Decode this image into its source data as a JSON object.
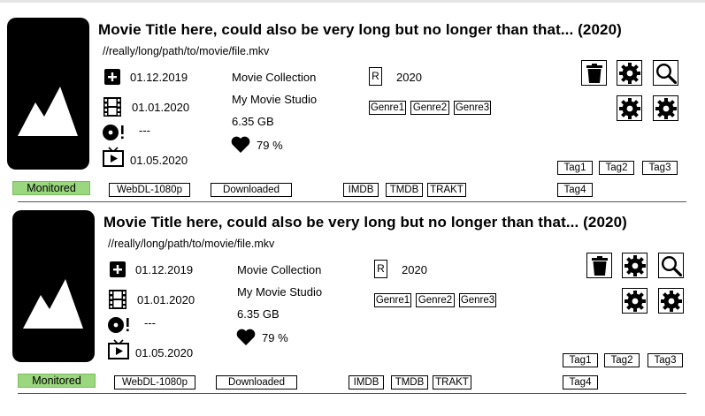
{
  "movies": [
    {
      "title": "Movie Title here, could also be very long but no longer than that... (2020)",
      "path": "//really/long/path/to/movie/file.mkv",
      "dates": {
        "added": "01.12.2019",
        "release": "01.01.2020",
        "digital": "---",
        "physical": "01.05.2020"
      },
      "collection": "Movie Collection",
      "studio": "My Movie Studio",
      "size": "6.35 GB",
      "rating": "79 %",
      "certification": "R",
      "year": "2020",
      "genres": [
        "Genre1",
        "Genre2",
        "Genre3"
      ],
      "tags": [
        "Tag1",
        "Tag2",
        "Tag3",
        "Tag4"
      ],
      "status": "Monitored",
      "quality": "WebDL-1080p",
      "file_status": "Downloaded",
      "links": [
        "IMDB",
        "TMDB",
        "TRAKT"
      ]
    },
    {
      "title": "Movie Title here, could also be very long but no longer than that... (2020)",
      "path": "//really/long/path/to/movie/file.mkv",
      "dates": {
        "added": "01.12.2019",
        "release": "01.01.2020",
        "digital": "---",
        "physical": "01.05.2020"
      },
      "collection": "Movie Collection",
      "studio": "My Movie Studio",
      "size": "6.35 GB",
      "rating": "79 %",
      "certification": "R",
      "year": "2020",
      "genres": [
        "Genre1",
        "Genre2",
        "Genre3"
      ],
      "tags": [
        "Tag1",
        "Tag2",
        "Tag3",
        "Tag4"
      ],
      "status": "Monitored",
      "quality": "WebDL-1080p",
      "file_status": "Downloaded",
      "links": [
        "IMDB",
        "TMDB",
        "TRAKT"
      ]
    }
  ],
  "icons": {
    "added": "plus-square-icon",
    "release": "film-icon",
    "digital": "disc-icon",
    "physical": "tv-play-icon",
    "rating": "heart-icon",
    "delete": "trash-icon",
    "settings": "gear-icon",
    "search": "search-icon",
    "poster": "image-placeholder-icon"
  },
  "colors": {
    "monitored": "#9ad77e"
  }
}
